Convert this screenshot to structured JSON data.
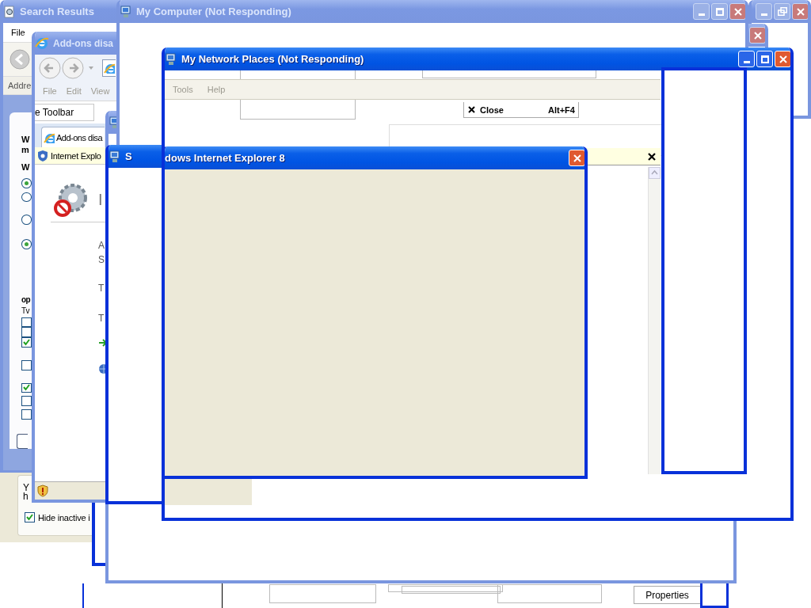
{
  "desktop": {
    "windows": [
      {
        "kind": "frame",
        "active": false,
        "title_buttons": [
          {
            "kind": "minimize"
          },
          {
            "kind": "restore"
          },
          {
            "kind": "close"
          }
        ]
      },
      {
        "kind": "frame",
        "active": false,
        "title_buttons": [
          {
            "kind": "close"
          }
        ]
      },
      {
        "kind": "search",
        "title": "Search Results",
        "active": false,
        "menu": [
          {
            "label": "File",
            "disabled": false
          }
        ],
        "address_label": "Addre",
        "panel": {
          "labels": [
            "W",
            "m",
            "W"
          ],
          "radios": [
            {
              "selected": true
            },
            {
              "selected": false
            },
            {
              "selected": false
            },
            {
              "selected": true
            }
          ],
          "heading": "op",
          "subheading": "Tv",
          "checkboxes": [
            {
              "checked": false
            },
            {
              "checked": false
            },
            {
              "checked": true
            },
            {
              "checked": false
            },
            {
              "checked": true
            },
            {
              "checked": false
            },
            {
              "checked": false
            }
          ]
        }
      },
      {
        "kind": "frame",
        "active": true
      },
      {
        "kind": "browser",
        "title": "Add-ons disa",
        "active": false,
        "menu": [
          {
            "label": "File",
            "disabled": true
          },
          {
            "label": "Edit",
            "disabled": true
          },
          {
            "label": "View",
            "disabled": true
          }
        ],
        "toolbar_field": "e Toolbar",
        "tab": "Add-ons disa",
        "infobar": "Internet Explo",
        "heading": "I",
        "lines": [
          "A",
          "S",
          "T",
          "T"
        ]
      },
      {
        "kind": "notice",
        "lines": [
          "Y",
          "h"
        ],
        "option": {
          "label": "Hide inactive i",
          "checked": true
        }
      },
      {
        "kind": "blank",
        "active": false
      },
      {
        "kind": "explorer",
        "title": "My Computer (Not Responding)",
        "active": false,
        "title_buttons": [
          {
            "kind": "minimize"
          },
          {
            "kind": "maximize"
          },
          {
            "kind": "close"
          }
        ]
      },
      {
        "kind": "blank",
        "title": "S",
        "active": true
      },
      {
        "kind": "explorer",
        "title": "My Network Places (Not Responding)",
        "active": true,
        "title_buttons": [
          {
            "kind": "minimize"
          },
          {
            "kind": "maximize"
          },
          {
            "kind": "close"
          }
        ],
        "menu": [
          {
            "label": "Tools",
            "disabled": true
          },
          {
            "label": "Help",
            "disabled": true
          }
        ],
        "ghost_menu": {
          "label": "Close",
          "shortcut": "Alt+F4"
        }
      },
      {
        "kind": "frame",
        "active": true
      },
      {
        "kind": "dialog",
        "title": "dows Internet Explorer 8",
        "active": true,
        "title_buttons": [
          {
            "kind": "close"
          }
        ]
      }
    ],
    "remnant": {
      "button": "Properties"
    }
  }
}
